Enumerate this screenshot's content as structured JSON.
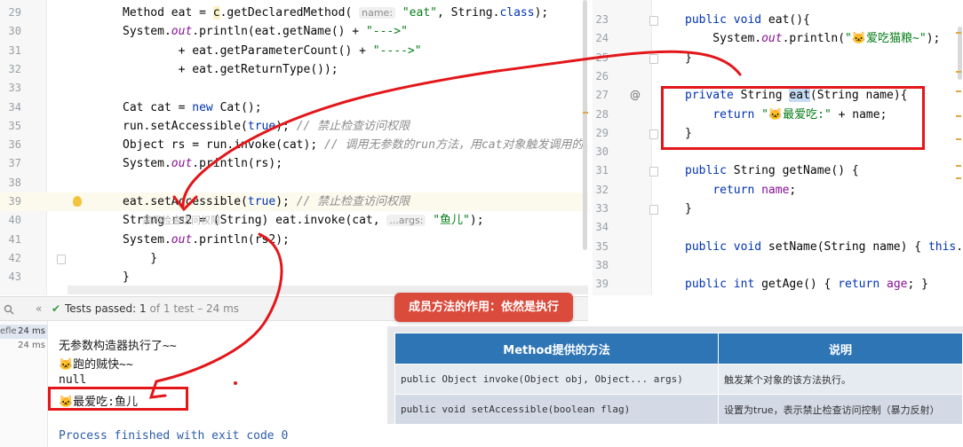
{
  "left_editor": {
    "lines": [
      {
        "num": "29",
        "parts": [
          [
            "p",
            "Method eat = "
          ],
          [
            "hl",
            "c"
          ],
          [
            "p",
            ".getDeclaredMethod( "
          ],
          [
            "hint",
            "name:"
          ],
          [
            "p",
            " "
          ],
          [
            "s",
            "\"eat\""
          ],
          [
            "p",
            ", String."
          ],
          [
            "k",
            "class"
          ],
          [
            "p",
            ");"
          ]
        ]
      },
      {
        "num": "30",
        "parts": [
          [
            "p",
            "System."
          ],
          [
            "i",
            "out"
          ],
          [
            "p",
            ".println(eat.getName() + "
          ],
          [
            "s",
            "\"--->\""
          ]
        ]
      },
      {
        "num": "31",
        "parts": [
          [
            "p",
            "        + eat.getParameterCount() + "
          ],
          [
            "s",
            "\"---->\""
          ]
        ]
      },
      {
        "num": "32",
        "parts": [
          [
            "p",
            "        + eat.getReturnType());"
          ]
        ]
      },
      {
        "num": "33",
        "parts": []
      },
      {
        "num": "34",
        "parts": [
          [
            "p",
            "Cat cat = "
          ],
          [
            "k",
            "new"
          ],
          [
            "p",
            " Cat();"
          ]
        ]
      },
      {
        "num": "35",
        "parts": [
          [
            "p",
            "run.setAccessible("
          ],
          [
            "k",
            "true"
          ],
          [
            "p",
            "); "
          ],
          [
            "c",
            "// 禁止检查访问权限"
          ]
        ]
      },
      {
        "num": "36",
        "parts": [
          [
            "p",
            "Object rs = run.invoke(cat); "
          ],
          [
            "c",
            "// 调用无参数的run方法，用cat对象触发调用的。"
          ]
        ]
      },
      {
        "num": "37",
        "parts": [
          [
            "p",
            "System."
          ],
          [
            "i",
            "out"
          ],
          [
            "p",
            ".println(rs);"
          ]
        ]
      },
      {
        "num": "38",
        "parts": []
      },
      {
        "num": "39",
        "parts": [
          [
            "p",
            "eat.setAccessible("
          ],
          [
            "k",
            "true"
          ],
          [
            "p",
            "); "
          ],
          [
            "c",
            "// 禁止检查访问权限"
          ]
        ]
      },
      {
        "num": "40",
        "parts": [
          [
            "p",
            "String rs2 = (String) eat.invoke(cat, "
          ],
          [
            "hint",
            "...args:"
          ],
          [
            "p",
            " "
          ],
          [
            "s",
            "\"鱼儿\""
          ],
          [
            "p",
            ");"
          ]
        ]
      },
      {
        "num": "41",
        "parts": [
          [
            "p",
            "System."
          ],
          [
            "i",
            "out"
          ],
          [
            "p",
            ".println(rs2);"
          ]
        ]
      },
      {
        "num": "42",
        "parts": [
          [
            "p",
            "    }"
          ]
        ]
      },
      {
        "num": "43",
        "parts": [
          [
            "p",
            "}"
          ]
        ]
      }
    ],
    "ghost_text": "禁用检查访问权限"
  },
  "right_editor": {
    "lines": [
      {
        "num": "23",
        "parts": [
          [
            "k",
            "public void"
          ],
          [
            "p",
            " eat(){"
          ]
        ]
      },
      {
        "num": "24",
        "parts": [
          [
            "p",
            "    System."
          ],
          [
            "i",
            "out"
          ],
          [
            "p",
            ".println("
          ],
          [
            "s",
            "\"🐱爱吃猫粮~\""
          ],
          [
            "p",
            ");"
          ]
        ]
      },
      {
        "num": "25",
        "parts": [
          [
            "p",
            "}"
          ]
        ]
      },
      {
        "num": "26",
        "parts": []
      },
      {
        "num": "27",
        "parts": [
          [
            "k",
            "private"
          ],
          [
            "p",
            " String "
          ],
          [
            "eat",
            "eat"
          ],
          [
            "p",
            "(String name){"
          ]
        ]
      },
      {
        "num": "28",
        "parts": [
          [
            "p",
            "    "
          ],
          [
            "k",
            "return"
          ],
          [
            "p",
            " "
          ],
          [
            "s",
            "\"🐱最爱吃:\""
          ],
          [
            "p",
            " + name;"
          ]
        ]
      },
      {
        "num": "29",
        "parts": [
          [
            "p",
            "}"
          ]
        ]
      },
      {
        "num": "30",
        "parts": []
      },
      {
        "num": "31",
        "parts": [
          [
            "k",
            "public"
          ],
          [
            "p",
            " String getName() {"
          ]
        ]
      },
      {
        "num": "32",
        "parts": [
          [
            "p",
            "    "
          ],
          [
            "k",
            "return"
          ],
          [
            "p",
            " "
          ],
          [
            "f",
            "name"
          ],
          [
            "p",
            ";"
          ]
        ]
      },
      {
        "num": "33",
        "parts": [
          [
            "p",
            "}"
          ]
        ]
      },
      {
        "num": "34",
        "parts": []
      },
      {
        "num": "35",
        "parts": [
          [
            "k",
            "public void"
          ],
          [
            "p",
            " setName(String name) { "
          ],
          [
            "k",
            "this"
          ],
          [
            "p",
            "."
          ]
        ]
      },
      {
        "num": "38",
        "parts": []
      },
      {
        "num": "39",
        "parts": [
          [
            "k",
            "public int"
          ],
          [
            "p",
            " getAge() { "
          ],
          [
            "k",
            "return"
          ],
          [
            "p",
            " "
          ],
          [
            "f",
            "age"
          ],
          [
            "p",
            "; }"
          ]
        ]
      }
    ],
    "at_symbol": "@"
  },
  "run_panel": {
    "status_label": "Tests passed:",
    "passed_count": "1",
    "of_text": "of 1 test",
    "duration": "– 24 ms",
    "tree": [
      {
        "name": "efle",
        "time": "24 ms"
      },
      {
        "name": "",
        "time": "24 ms"
      }
    ],
    "output": [
      "无参数构造器执行了~~",
      "🐱跑的贼快~~",
      "null",
      "🐱最爱吃:鱼儿",
      "",
      "Process finished with exit code 0"
    ]
  },
  "slide": {
    "tag": "成员方法的作用：依然是执行",
    "table_headers": [
      "Method提供的方法",
      "说明"
    ],
    "rows": [
      {
        "method": "public Object invoke(Object obj, Object... args)",
        "desc": "触发某个对象的该方法执行。"
      },
      {
        "method": "public void  setAccessible(boolean flag)",
        "desc": "设置为true，表示禁止检查访问控制（暴力反射）"
      }
    ]
  },
  "colors": {
    "annotation_red": "#e3161a",
    "table_header": "#2e75b6",
    "tag_bg": "#db4b3c",
    "pass_green": "#3d9b47"
  }
}
